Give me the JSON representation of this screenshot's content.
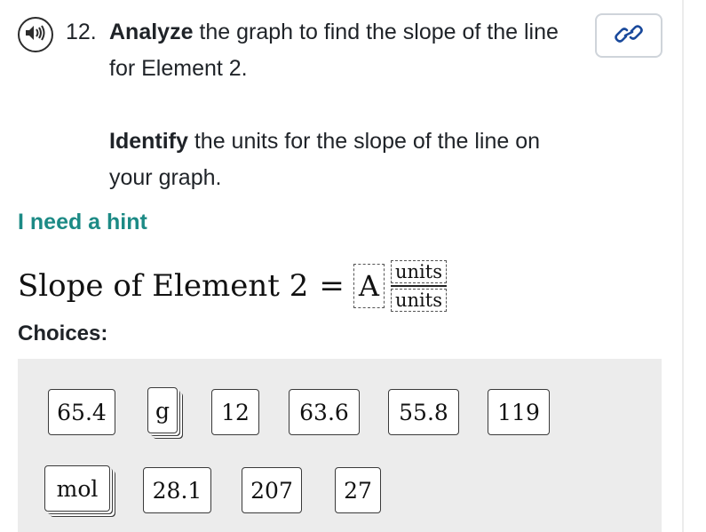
{
  "question": {
    "number": "12.",
    "line1_bold": "Analyze",
    "line1_rest": " the graph to find the slope of the line",
    "line2": "for Element 2.",
    "line3_bold": "Identify",
    "line3_rest": " the units for the slope of the line on",
    "line4": "your graph."
  },
  "hint_label": "I need a hint",
  "equation": {
    "label": "Slope of Element 2",
    "equals": "=",
    "answer_value": "A",
    "numerator_unit": "units",
    "denominator_unit": "units"
  },
  "choices_label": "Choices:",
  "choices": [
    "65.4",
    "g",
    "12",
    "63.6",
    "55.8",
    "119",
    "mol",
    "28.1",
    "207",
    "27"
  ],
  "colors": {
    "hint": "#1c8a85",
    "tray": "#ececec",
    "link_border": "#cfd4da"
  },
  "icons": {
    "audio": "speaker-icon",
    "link": "link-icon"
  }
}
